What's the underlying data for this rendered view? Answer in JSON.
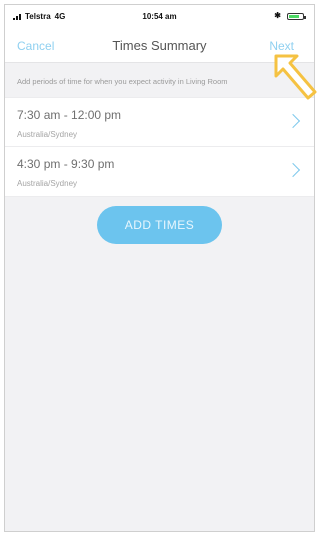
{
  "status_bar": {
    "carrier": "Telstra",
    "network": "4G",
    "time": "10:54 am",
    "bluetooth_icon": "bluetooth-icon",
    "battery_icon": "battery-icon",
    "battery_level": 0.8
  },
  "nav": {
    "cancel_label": "Cancel",
    "title": "Times Summary",
    "next_label": "Next"
  },
  "instruction": "Add periods of time for when you expect activity in Living Room",
  "times": [
    {
      "range": "7:30 am - 12:00 pm",
      "timezone": "Australia/Sydney"
    },
    {
      "range": "4:30 pm - 9:30 pm",
      "timezone": "Australia/Sydney"
    }
  ],
  "add_button_label": "ADD TIMES",
  "colors": {
    "accent": "#6cc4ee",
    "link": "#8fd0f0",
    "annotation_arrow": "#f5c242"
  }
}
